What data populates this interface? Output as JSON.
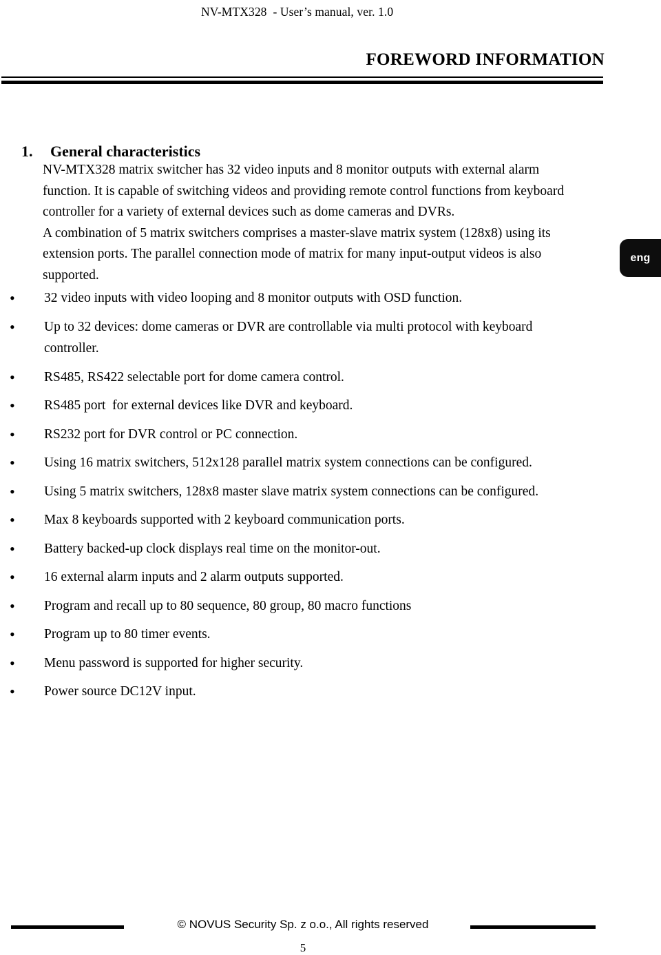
{
  "header": {
    "running_head": "NV-MTX328  - User’s manual, ver. 1.0",
    "title": "FOREWORD INFORMATION"
  },
  "section": {
    "number": "1.",
    "heading": "General characteristics"
  },
  "body": {
    "paragraph_1": "NV-MTX328 matrix switcher has 32 video inputs and 8 monitor outputs with external alarm function. It is capable of switching videos and providing remote control functions from keyboard controller for a variety of external devices such as dome cameras and DVRs.",
    "paragraph_2": "A combination of 5 matrix switchers comprises a master-slave matrix system (128x8) using its extension ports. The parallel connection mode of matrix for many input-output videos is also supported."
  },
  "language_tab": {
    "label": "eng",
    "color": "#0d0d0d"
  },
  "features": {
    "bullet_glyph": "•",
    "items": [
      "32 video inputs with video looping and 8 monitor outputs with OSD function.",
      "Up to 32 devices: dome cameras or DVR are controllable via multi protocol with keyboard controller.",
      "RS485, RS422 selectable port for dome camera control.",
      "RS485 port  for external devices like DVR and keyboard.",
      "RS232 port for DVR control or PC connection.",
      "Using 16 matrix switchers, 512x128 parallel matrix system connections can be configured.",
      "Using 5 matrix switchers, 128x8 master slave matrix system connections can be configured.",
      "Max 8 keyboards supported with 2 keyboard communication ports.",
      "Battery backed-up clock displays real time on the monitor-out.",
      "16 external alarm inputs and 2 alarm outputs supported.",
      "Program and recall up to 80 sequence, 80 group, 80 macro functions",
      "Program up to 80 timer events.",
      "Menu password is supported for higher security.",
      "Power source DC12V input."
    ]
  },
  "footer": {
    "copyright": "© NOVUS Security Sp. z o.o., All rights reserved",
    "page_number": "5"
  }
}
